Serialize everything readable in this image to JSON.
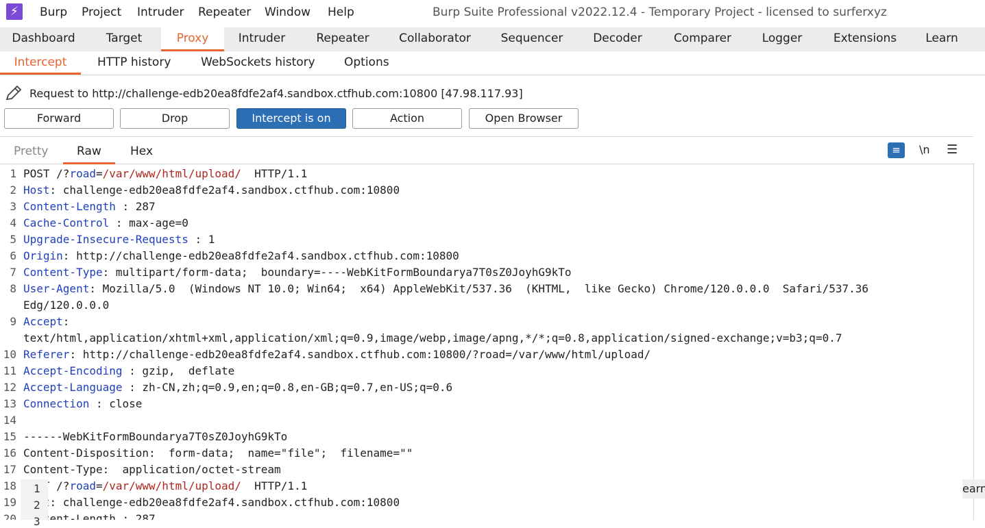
{
  "app": {
    "logo_glyph": "⚡",
    "window_title": "Burp Suite Professional v2022.12.4 - Temporary Project - licensed to surferxyz",
    "menu": [
      "Burp",
      "Project",
      "Intruder",
      "Repeater",
      "Window",
      "Help"
    ]
  },
  "main_tabs": [
    "Dashboard",
    "Target",
    "Proxy",
    "Intruder",
    "Repeater",
    "Collaborator",
    "Sequencer",
    "Decoder",
    "Comparer",
    "Logger",
    "Extensions",
    "Learn"
  ],
  "main_active": "Proxy",
  "sub_tabs": [
    "Intercept",
    "HTTP history",
    "WebSockets history",
    "Options"
  ],
  "sub_active": "Intercept",
  "request": {
    "label": "Request to http://challenge-edb20ea8fdfe2af4.sandbox.ctfhub.com:10800  [47.98.117.93]"
  },
  "buttons": [
    "Forward",
    "Drop",
    "Intercept is on",
    "Action",
    "Open Browser"
  ],
  "editor_tabs": [
    "Pretty",
    "Raw",
    "Hex"
  ],
  "editor_active": "Raw",
  "editor_icons": {
    "wrap": "wrap-lines-icon",
    "newline_label": "\\n",
    "menu": "hamburger-icon"
  },
  "lines": [
    {
      "n": "1",
      "parts": [
        [
          "POST /?",
          ""
        ],
        [
          "road",
          "h"
        ],
        [
          "=",
          ""
        ],
        [
          "/var/www/html/upload/",
          "v"
        ],
        [
          "  HTTP/1.1",
          ""
        ]
      ]
    },
    {
      "n": "2",
      "parts": [
        [
          "Host",
          "h"
        ],
        [
          ": challenge-edb20ea8fdfe2af4.sandbox.ctfhub.com:10800",
          ""
        ]
      ]
    },
    {
      "n": "3",
      "parts": [
        [
          "Content-Length",
          "h"
        ],
        [
          " : 287",
          ""
        ]
      ]
    },
    {
      "n": "4",
      "parts": [
        [
          "Cache-Control",
          "h"
        ],
        [
          " : max-age=0",
          ""
        ]
      ]
    },
    {
      "n": "5",
      "parts": [
        [
          "Upgrade-Insecure-Requests",
          "h"
        ],
        [
          " : 1",
          ""
        ]
      ]
    },
    {
      "n": "6",
      "parts": [
        [
          "Origin",
          "h"
        ],
        [
          ": http://challenge-edb20ea8fdfe2af4.sandbox.ctfhub.com:10800",
          ""
        ]
      ]
    },
    {
      "n": "7",
      "parts": [
        [
          "Content-Type",
          "h"
        ],
        [
          ": multipart/form-data;  boundary=----WebKitFormBoundarya7T0sZ0JoyhG9kTo",
          ""
        ]
      ]
    },
    {
      "n": "8",
      "parts": [
        [
          "User-Agent",
          "h"
        ],
        [
          ": Mozilla/5.0  (Windows NT 10.0; Win64;  x64) AppleWebKit/537.36  (KHTML,  like Gecko) Chrome/120.0.0.0  Safari/537.36",
          ""
        ]
      ]
    },
    {
      "n": "",
      "parts": [
        [
          "Edg/120.0.0.0",
          ""
        ]
      ]
    },
    {
      "n": "9",
      "parts": [
        [
          "Accept",
          "h"
        ],
        [
          ":",
          ""
        ]
      ]
    },
    {
      "n": "",
      "parts": [
        [
          "text/html,application/xhtml+xml,application/xml;q=0.9,image/webp,image/apng,*/*;q=0.8,application/signed-exchange;v=b3;q=0.7",
          ""
        ]
      ]
    },
    {
      "n": "10",
      "parts": [
        [
          "Referer",
          "h"
        ],
        [
          ": http://challenge-edb20ea8fdfe2af4.sandbox.ctfhub.com:10800/?road=/var/www/html/upload/",
          ""
        ]
      ]
    },
    {
      "n": "11",
      "parts": [
        [
          "Accept-Encoding",
          "h"
        ],
        [
          " : gzip,  deflate",
          ""
        ]
      ]
    },
    {
      "n": "12",
      "parts": [
        [
          "Accept-Language",
          "h"
        ],
        [
          " : zh-CN,zh;q=0.9,en;q=0.8,en-GB;q=0.7,en-US;q=0.6",
          ""
        ]
      ]
    },
    {
      "n": "13",
      "parts": [
        [
          "Connection",
          "h"
        ],
        [
          " : close",
          ""
        ]
      ]
    },
    {
      "n": "14",
      "parts": [
        [
          "",
          ""
        ]
      ]
    },
    {
      "n": "15",
      "parts": [
        [
          "------WebKitFormBoundarya7T0sZ0JoyhG9kTo",
          ""
        ]
      ]
    },
    {
      "n": "16",
      "parts": [
        [
          "Content-Disposition:  form-data;  name=\"file\";  filename=\"\"",
          ""
        ]
      ]
    },
    {
      "n": "17",
      "parts": [
        [
          "Content-Type:  application/octet-stream",
          ""
        ]
      ]
    },
    {
      "n": "18",
      "parts": [
        [
          "   T /?",
          ""
        ],
        [
          "road",
          "h"
        ],
        [
          "=",
          ""
        ],
        [
          "/var/www/html/upload/",
          "v"
        ],
        [
          "  HTTP/1.1",
          ""
        ]
      ]
    },
    {
      "n": "19",
      "parts": [
        [
          "   t: challenge-edb20ea8fdfe2af4.sandbox.ctfhub.com:10800",
          ""
        ]
      ]
    },
    {
      "n": "20",
      "parts": [
        [
          "   tent-Length : 287",
          ""
        ]
      ]
    }
  ],
  "overlay_numbers": [
    "1",
    "2",
    "3"
  ],
  "learn_peek": "earn"
}
